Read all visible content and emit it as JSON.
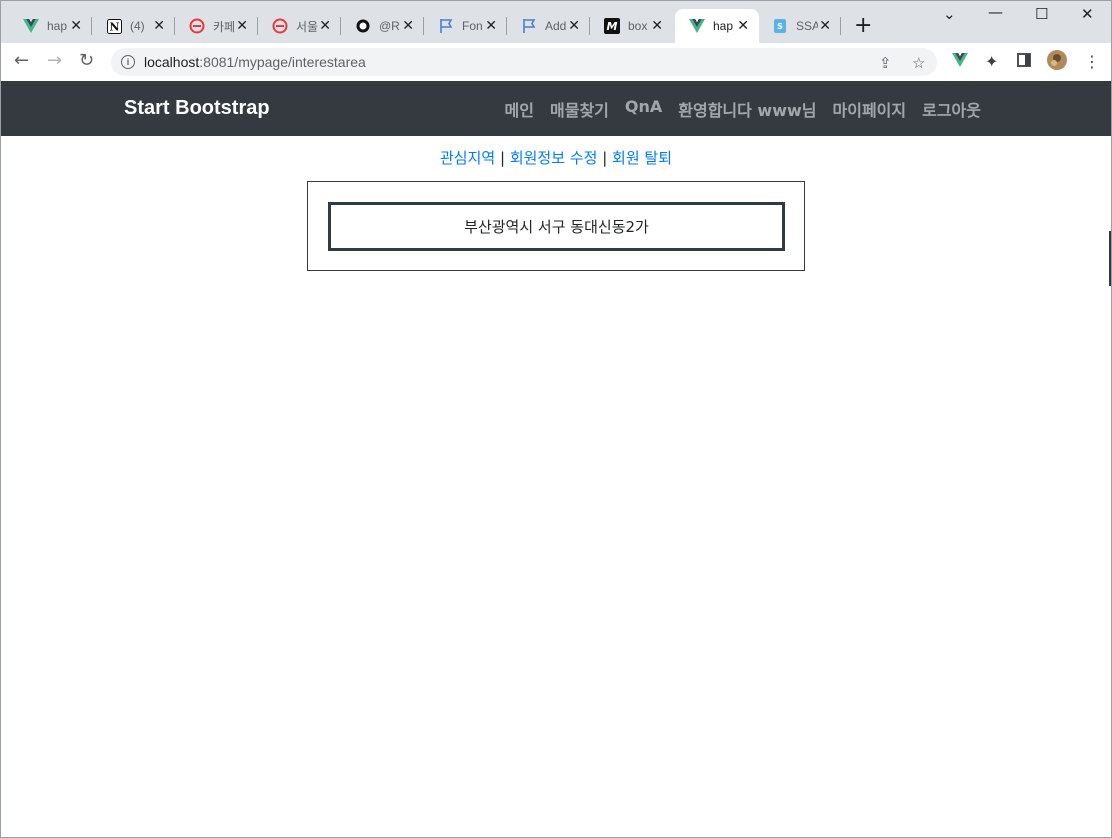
{
  "browser": {
    "tabs": [
      {
        "title": "hap",
        "icon": "vue-icon"
      },
      {
        "title": "(4)",
        "icon": "notion-icon"
      },
      {
        "title": "카페",
        "icon": "red-circle-icon"
      },
      {
        "title": "서울",
        "icon": "red-circle-icon"
      },
      {
        "title": "@R",
        "icon": "circle-logo-icon"
      },
      {
        "title": "Fon",
        "icon": "flag-icon"
      },
      {
        "title": "Add",
        "icon": "flag-icon"
      },
      {
        "title": "box",
        "icon": "m-logo-icon"
      },
      {
        "title": "hap",
        "icon": "vue-icon",
        "active": true
      },
      {
        "title": "SSA",
        "icon": "doc-icon"
      }
    ],
    "url_host": "localhost",
    "url_path": ":8081/mypage/interestarea"
  },
  "navbar": {
    "brand": "Start Bootstrap",
    "links": [
      "메인",
      "매물찾기",
      "QnA",
      "환영합니다 www님",
      "마이페이지",
      "로그아웃"
    ]
  },
  "subnav": {
    "interest": "관심지역",
    "edit": "회원정보 수정",
    "withdraw": "회원 탈퇴",
    "separator": "|"
  },
  "interest_areas": [
    "부산광역시 서구 동대신동2가"
  ],
  "colors": {
    "navbar_bg": "#343a40",
    "link": "#007bff",
    "tabstrip_bg": "#dee1e6"
  }
}
